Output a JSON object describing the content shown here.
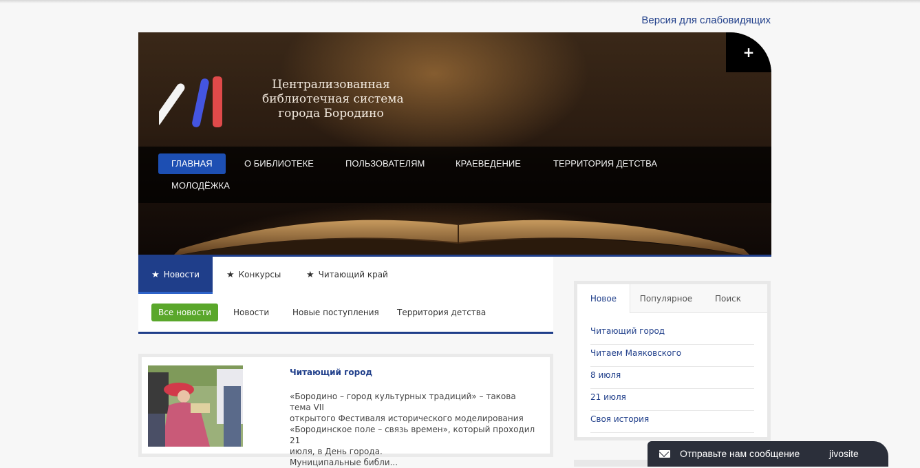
{
  "accessibility_link": "Версия для слабовидящих",
  "header": {
    "plus_icon": "+",
    "title_lines": [
      "Централизованная",
      "библиотечная система",
      "города Бородино"
    ],
    "logo_colors": [
      "#ffffff",
      "#4455e0",
      "#e04a4a"
    ]
  },
  "nav": {
    "items": [
      {
        "label": "ГЛАВНАЯ",
        "active": true
      },
      {
        "label": "О БИБЛИОТЕКЕ"
      },
      {
        "label": "ПОЛЬЗОВАТЕЛЯМ"
      },
      {
        "label": "КРАЕВЕДЕНИЕ"
      },
      {
        "label": "ТЕРРИТОРИЯ ДЕТСТВА"
      },
      {
        "label": "МОЛОДЁЖКА"
      }
    ]
  },
  "main_tabs": [
    {
      "label": "Новости",
      "active": true
    },
    {
      "label": "Конкурсы"
    },
    {
      "label": "Читающий край"
    }
  ],
  "sub_tabs": [
    {
      "label": "Все новости",
      "active": true
    },
    {
      "label": "Новости"
    },
    {
      "label": "Новые поступления"
    },
    {
      "label": "Территория детства"
    }
  ],
  "article": {
    "title": "Читающий город",
    "text_lines": [
      "«Бородино – город культурных традиций» – такова тема VII",
      "открытого Фестиваля исторического моделирования",
      "«Бородинское поле – связь времен», который проходил 21",
      "июля, в День города.",
      "Муниципальные библи..."
    ]
  },
  "sidebar": {
    "tabs": [
      {
        "label": "Новое",
        "active": true
      },
      {
        "label": "Популярное"
      },
      {
        "label": "Поиск"
      }
    ],
    "items": [
      "Читающий город",
      "Читаем Маяковского",
      "8 июля",
      "21 июля",
      "Своя история"
    ]
  },
  "jivo": {
    "message": "Отправьте нам сообщение",
    "brand": "jivosite"
  },
  "colors": {
    "accent_blue": "#1f3e8a",
    "nav_active": "#1d4fb3",
    "green": "#5aa72b",
    "jivo_bg": "#2b2f3a"
  }
}
